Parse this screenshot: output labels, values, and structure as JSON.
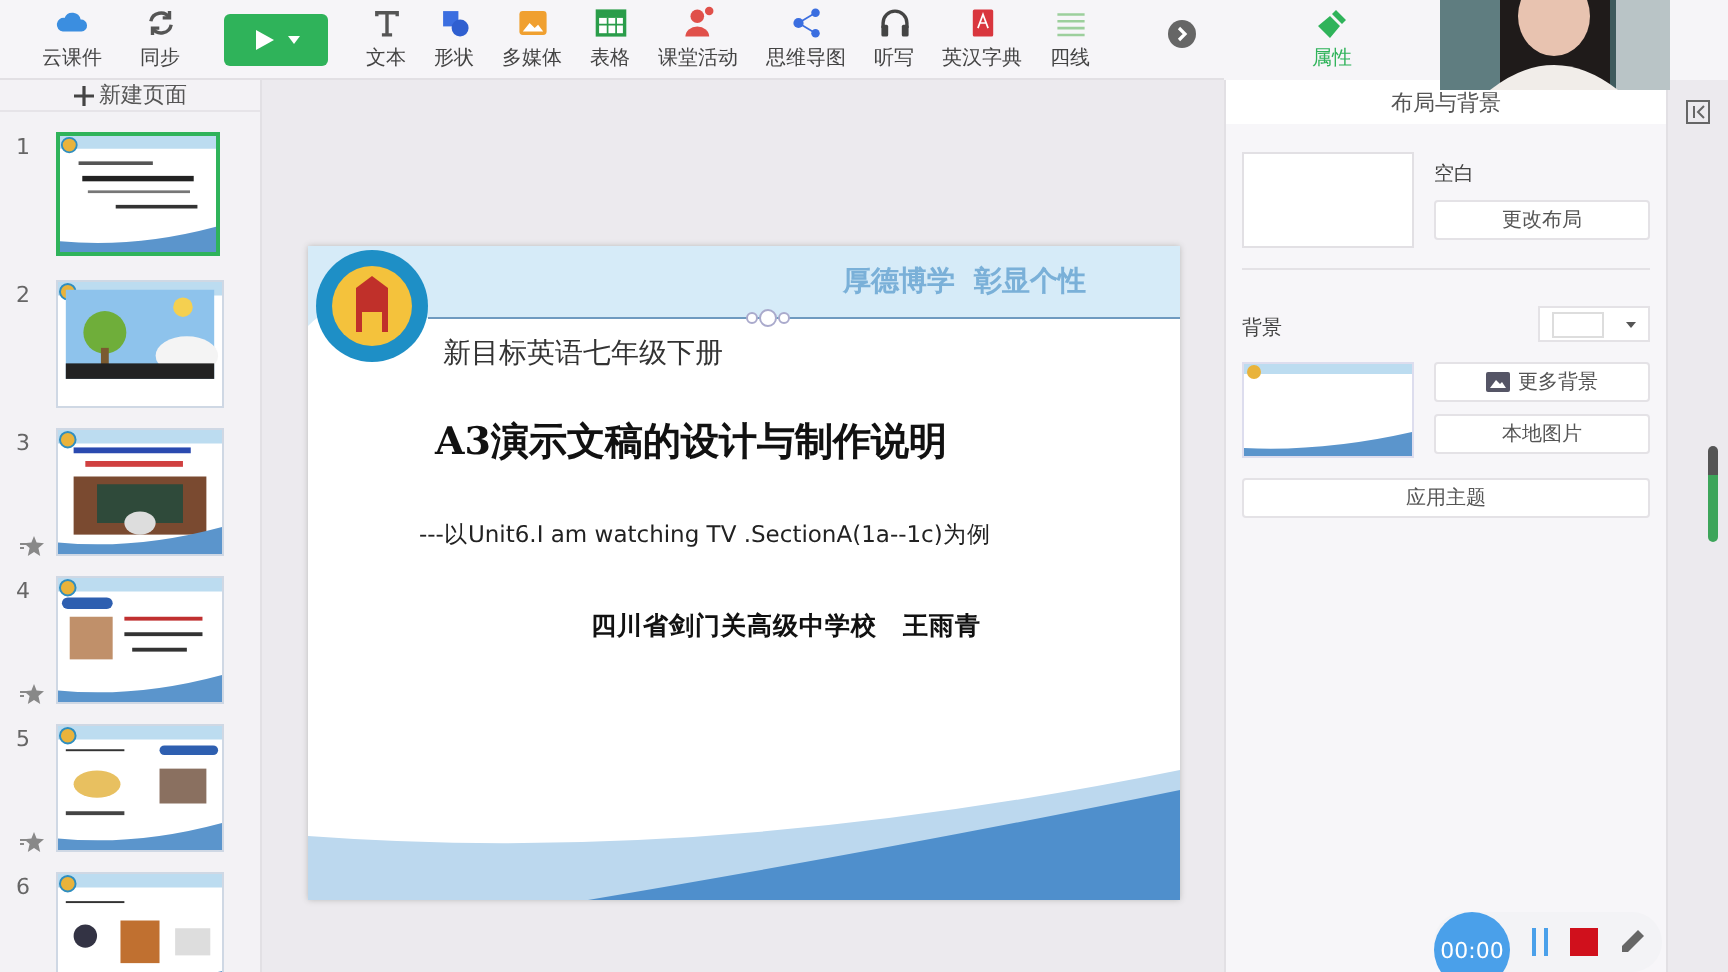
{
  "toolbar": {
    "items": [
      {
        "label": "云课件"
      },
      {
        "label": "同步"
      },
      {
        "label": "文本"
      },
      {
        "label": "形状"
      },
      {
        "label": "多媒体"
      },
      {
        "label": "表格"
      },
      {
        "label": "课堂活动"
      },
      {
        "label": "思维导图"
      },
      {
        "label": "听写"
      },
      {
        "label": "英汉字典"
      },
      {
        "label": "四线"
      }
    ],
    "properties_tab": {
      "label": "属性",
      "selected": true
    }
  },
  "sidebar": {
    "new_page": "新建页面",
    "slides": [
      {
        "number": "1",
        "selected": true,
        "animated": false
      },
      {
        "number": "2",
        "selected": false,
        "animated": false
      },
      {
        "number": "3",
        "selected": false,
        "animated": true
      },
      {
        "number": "4",
        "selected": false,
        "animated": true
      },
      {
        "number": "5",
        "selected": false,
        "animated": true
      },
      {
        "number": "6",
        "selected": false,
        "animated": false
      }
    ]
  },
  "slide": {
    "motto": "厚德博学  彰显个性",
    "course": "新目标英语七年级下册",
    "title": "A3演示文稿的设计与制作说明",
    "subtitle": "---以Unit6.I am watching TV .SectionA(1a--1c)为例",
    "author": "四川省剑门关高级中学校　王雨青"
  },
  "panel": {
    "title": "布局与背景",
    "layout_name": "空白",
    "change_layout": "更改布局",
    "background_label": "背景",
    "more_backgrounds": "更多背景",
    "local_image": "本地图片",
    "apply_theme": "应用主题"
  },
  "recorder": {
    "time": "00:00"
  }
}
